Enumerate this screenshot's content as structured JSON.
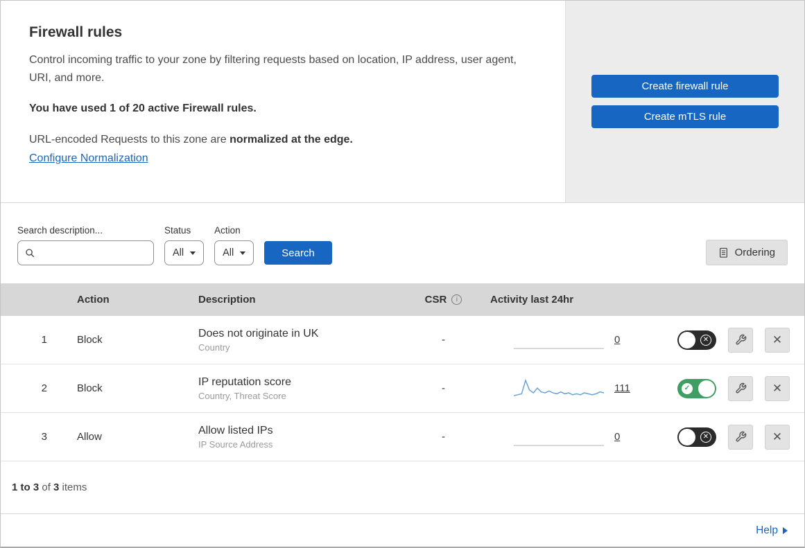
{
  "header": {
    "title": "Firewall rules",
    "description": "Control incoming traffic to your zone by filtering requests based on location, IP address, user agent, URI, and more.",
    "usage": "You have used 1 of 20 active Firewall rules.",
    "normalization": {
      "prefix": "URL-encoded Requests to this zone are ",
      "bold": "normalized at the edge.",
      "link": "Configure Normalization"
    },
    "actions": {
      "create_firewall_rule": "Create firewall rule",
      "create_mtls_rule": "Create mTLS rule"
    }
  },
  "filters": {
    "search_label": "Search description...",
    "status": {
      "label": "Status",
      "value": "All"
    },
    "action": {
      "label": "Action",
      "value": "All"
    },
    "search_button": "Search",
    "ordering_button": "Ordering"
  },
  "table": {
    "headers": {
      "action": "Action",
      "description": "Description",
      "csr": "CSR",
      "activity": "Activity last 24hr"
    },
    "rows": [
      {
        "index": "1",
        "action": "Block",
        "description": "Does not originate in UK",
        "criteria": "Country",
        "csr": "-",
        "count": "0",
        "enabled": false,
        "sparkline": []
      },
      {
        "index": "2",
        "action": "Block",
        "description": "IP reputation score",
        "criteria": "Country, Threat Score",
        "csr": "-",
        "count": "111",
        "enabled": true,
        "sparkline": [
          1,
          1.5,
          2,
          9,
          4,
          2.5,
          5,
          3,
          2.5,
          3.5,
          2.5,
          2,
          3,
          2,
          2.5,
          1.5,
          2,
          1.5,
          2.5,
          2,
          1.5,
          2,
          3,
          2.5
        ]
      },
      {
        "index": "3",
        "action": "Allow",
        "description": "Allow listed IPs",
        "criteria": "IP Source Address",
        "csr": "-",
        "count": "0",
        "enabled": false,
        "sparkline": []
      }
    ]
  },
  "footer": {
    "range": "1 to 3",
    "of": " of ",
    "total": "3",
    "items": " items",
    "help": "Help"
  },
  "colors": {
    "accent_blue": "#1766c2",
    "toggle_on_green": "#3f9e63",
    "toggle_off_dark": "#2b2b2b",
    "table_header_bg": "#d7d7d7",
    "side_panel_bg": "#ececec",
    "sparkline_blue": "#6aa3d8"
  }
}
